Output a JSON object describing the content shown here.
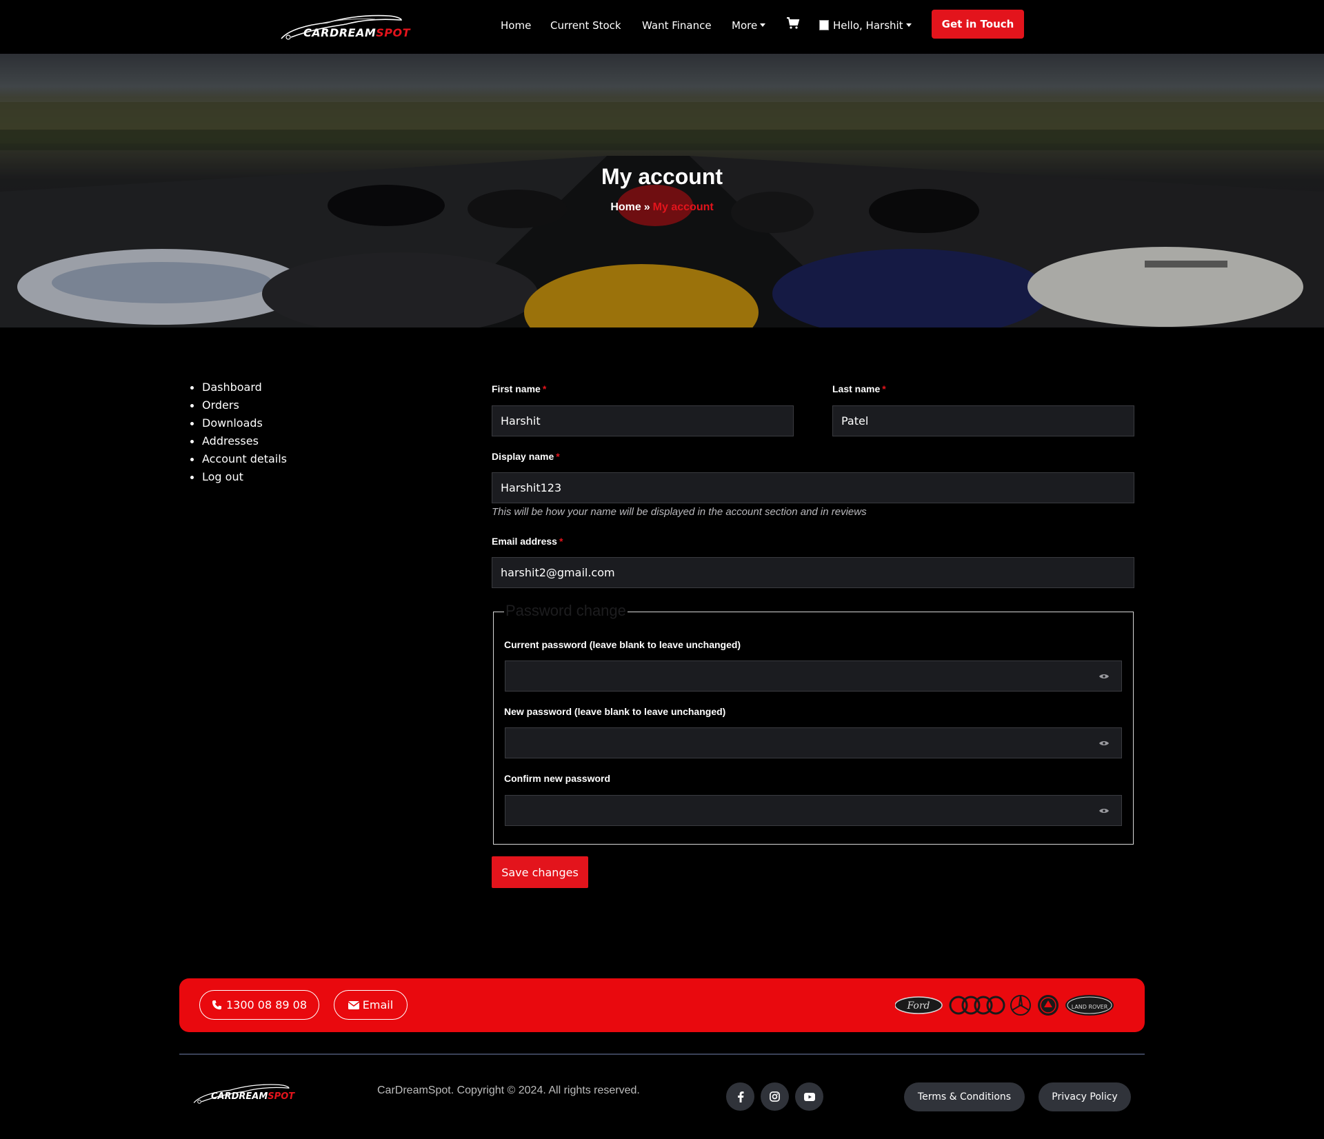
{
  "header": {
    "logo": {
      "word1": "CARDREAM",
      "word2": "SPOT"
    },
    "nav": [
      "Home",
      "Current Stock",
      "Want Finance",
      "More"
    ],
    "user_greeting": "Hello, Harshit",
    "cta": "Get in Touch"
  },
  "hero": {
    "title": "My account",
    "breadcrumb": {
      "home": "Home",
      "separator": "»",
      "current": "My account"
    }
  },
  "sidebar": {
    "items": [
      "Dashboard",
      "Orders",
      "Downloads",
      "Addresses",
      "Account details",
      "Log out"
    ]
  },
  "form": {
    "first_name": {
      "label": "First name",
      "value": "Harshit"
    },
    "last_name": {
      "label": "Last name",
      "value": "Patel"
    },
    "display_name": {
      "label": "Display name",
      "value": "Harshit123",
      "hint": "This will be how your name will be displayed in the account section and in reviews"
    },
    "email": {
      "label": "Email address",
      "value": "harshit2@gmail.com"
    },
    "required_marker": "*",
    "password_legend": "Password change",
    "current_password": {
      "label": "Current password (leave blank to leave unchanged)",
      "value": ""
    },
    "new_password": {
      "label": "New password (leave blank to leave unchanged)",
      "value": ""
    },
    "confirm_password": {
      "label": "Confirm new password",
      "value": ""
    },
    "save_label": "Save changes"
  },
  "footer": {
    "phone": "1300 08 89 08",
    "email_label": "Email",
    "brands": [
      "Ford",
      "Audi",
      "Mercedes-Benz",
      "Skoda",
      "LAND ROVER"
    ],
    "copyright": "CarDreamSpot. Copyright © 2024. All rights reserved.",
    "social": [
      "facebook-icon",
      "instagram-icon",
      "youtube-icon"
    ],
    "terms": "Terms & Conditions",
    "privacy": "Privacy Policy"
  },
  "colors": {
    "accent": "#e3141c",
    "background": "#000000",
    "field_bg": "#1b1c20",
    "pill_bg": "#30333a"
  }
}
